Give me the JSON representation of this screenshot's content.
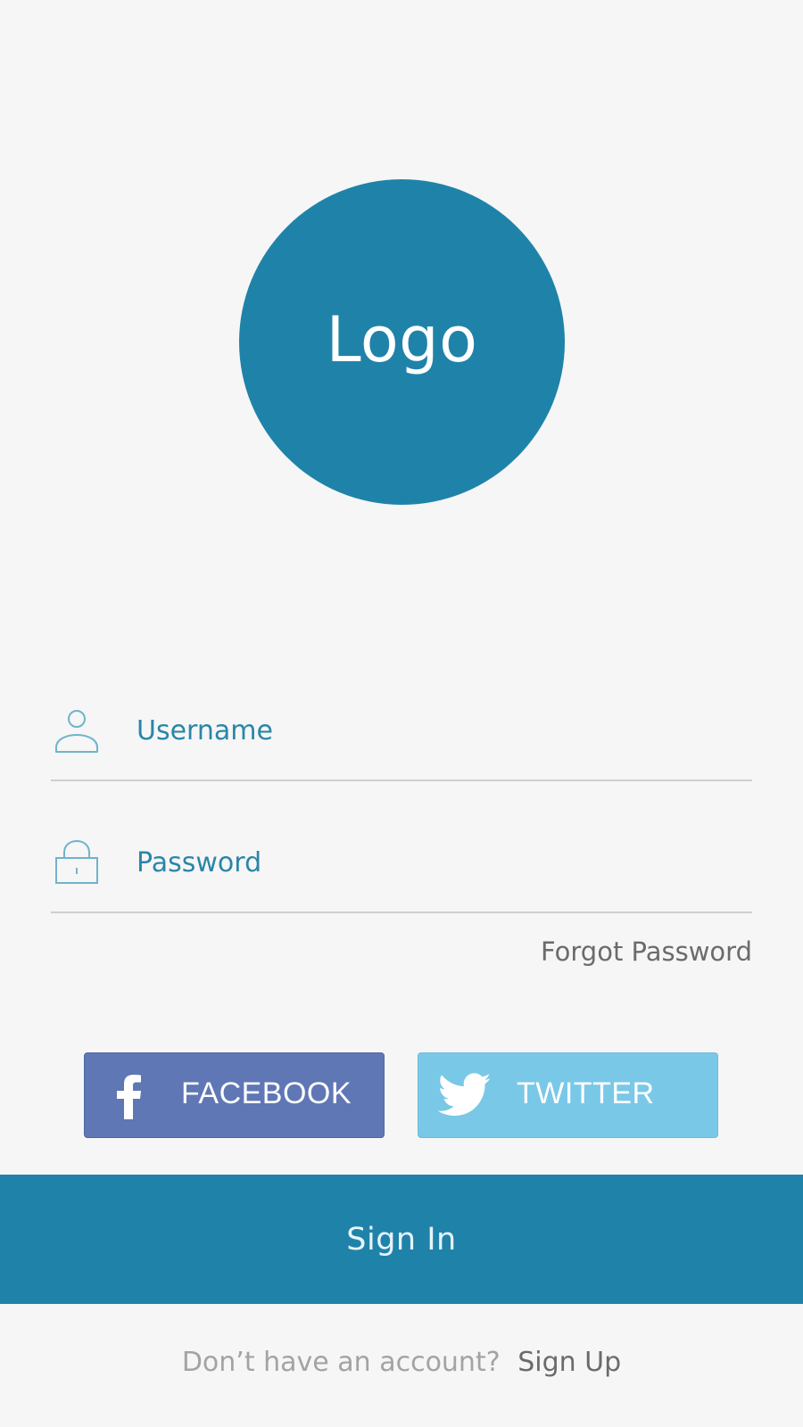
{
  "logo": {
    "text": "Logo"
  },
  "form": {
    "username": {
      "placeholder": "Username",
      "value": "",
      "icon": "user-icon"
    },
    "password": {
      "placeholder": "Password",
      "value": "",
      "icon": "lock-icon"
    },
    "forgot_label": "Forgot Password"
  },
  "social": {
    "facebook": {
      "label": "FACEBOOK",
      "icon": "facebook-icon",
      "color": "#6077b5"
    },
    "twitter": {
      "label": "TWITTER",
      "icon": "twitter-icon",
      "color": "#7ac8e7"
    }
  },
  "signin": {
    "label": "Sign In",
    "color": "#1f83a9"
  },
  "signup": {
    "prompt": "Don’t have an account?",
    "link_label": "Sign Up"
  },
  "colors": {
    "brand": "#1f83a9",
    "background": "#f6f6f6",
    "field_text": "#2a86a8",
    "divider": "#cfcfcf"
  }
}
